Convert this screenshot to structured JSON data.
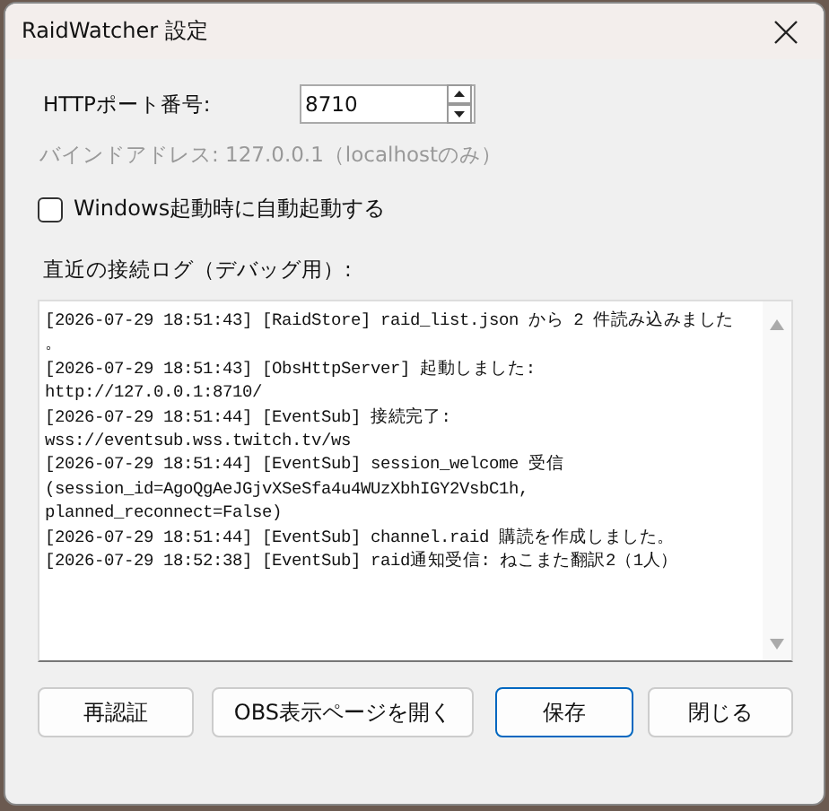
{
  "window": {
    "title": "RaidWatcher 設定"
  },
  "port": {
    "label": "HTTPポート番号:",
    "value": "8710"
  },
  "bind_note": "バインドアドレス: 127.0.0.1（localhostのみ）",
  "autostart": {
    "label": "Windows起動時に自動起動する",
    "checked": false
  },
  "log": {
    "label": "直近の接続ログ（デバッグ用）:",
    "lines": [
      "[2026-07-29 18:51:43] [RaidStore] raid_list.json から 2 件読み込みました",
      "。",
      "[2026-07-29 18:51:43] [ObsHttpServer] 起動しました:",
      "http://127.0.0.1:8710/",
      "[2026-07-29 18:51:44] [EventSub] 接続完了:",
      "wss://eventsub.wss.twitch.tv/ws",
      "[2026-07-29 18:51:44] [EventSub] session_welcome 受信",
      "(session_id=AgoQgAeJGjvXSeSfa4u4WUzXbhIGY2VsbC1h,",
      "planned_reconnect=False)",
      "[2026-07-29 18:51:44] [EventSub] channel.raid 購読を作成しました。",
      "[2026-07-29 18:52:38] [EventSub] raid通知受信: ねこまた翻訳2（1人）"
    ]
  },
  "buttons": [
    {
      "label": "再認証",
      "default": false
    },
    {
      "label": "OBS表示ページを開く",
      "default": false
    },
    {
      "label": "保存",
      "default": true
    },
    {
      "label": "閉じる",
      "default": false
    }
  ]
}
